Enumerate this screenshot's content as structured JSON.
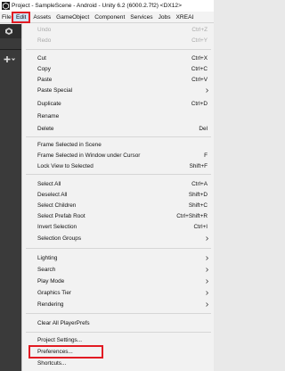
{
  "window": {
    "title": "Project - SampleScene - Android - Unity 6.2 (6000.2.7f2) <DX12>"
  },
  "menubar": {
    "items": [
      "File",
      "Edit",
      "Assets",
      "GameObject",
      "Component",
      "Services",
      "Jobs",
      "XREAL"
    ],
    "active": "Edit"
  },
  "edit_menu": {
    "items": [
      {
        "label": "Undo",
        "shortcut": "Ctrl+Z",
        "disabled": true
      },
      {
        "label": "Redo",
        "shortcut": "Ctrl+Y",
        "disabled": true
      },
      {
        "label": "Cut",
        "shortcut": "Ctrl+X"
      },
      {
        "label": "Copy",
        "shortcut": "Ctrl+C"
      },
      {
        "label": "Paste",
        "shortcut": "Ctrl+V"
      },
      {
        "label": "Paste Special",
        "submenu": true
      },
      {
        "label": "Duplicate",
        "shortcut": "Ctrl+D"
      },
      {
        "label": "Rename",
        "shortcut": ""
      },
      {
        "label": "Delete",
        "shortcut": "Del"
      },
      {
        "label": "Frame Selected in Scene",
        "shortcut": ""
      },
      {
        "label": "Frame Selected in Window under Cursor",
        "shortcut": "F"
      },
      {
        "label": "Lock View to Selected",
        "shortcut": "Shift+F"
      },
      {
        "label": "Select All",
        "shortcut": "Ctrl+A"
      },
      {
        "label": "Deselect All",
        "shortcut": "Shift+D"
      },
      {
        "label": "Select Children",
        "shortcut": "Shift+C"
      },
      {
        "label": "Select Prefab Root",
        "shortcut": "Ctrl+Shift+R"
      },
      {
        "label": "Invert Selection",
        "shortcut": "Ctrl+I"
      },
      {
        "label": "Selection Groups",
        "submenu": true
      },
      {
        "label": "Lighting",
        "submenu": true
      },
      {
        "label": "Search",
        "submenu": true
      },
      {
        "label": "Play Mode",
        "submenu": true
      },
      {
        "label": "Graphics Tier",
        "submenu": true
      },
      {
        "label": "Rendering",
        "submenu": true
      },
      {
        "label": "Clear All PlayerPrefs",
        "shortcut": ""
      },
      {
        "label": "Project Settings...",
        "shortcut": ""
      },
      {
        "label": "Preferences...",
        "shortcut": "",
        "highlighted": true
      },
      {
        "label": "Shortcuts...",
        "shortcut": ""
      }
    ]
  },
  "colors": {
    "highlight_border": "#e21b23",
    "active_menu_bg": "#cfe3f7",
    "menu_bg": "#f2f2f2",
    "disabled_text": "#a9a9a9"
  },
  "icons": {
    "app": "unity-logo-icon",
    "submenu": "chevron-right-icon"
  }
}
